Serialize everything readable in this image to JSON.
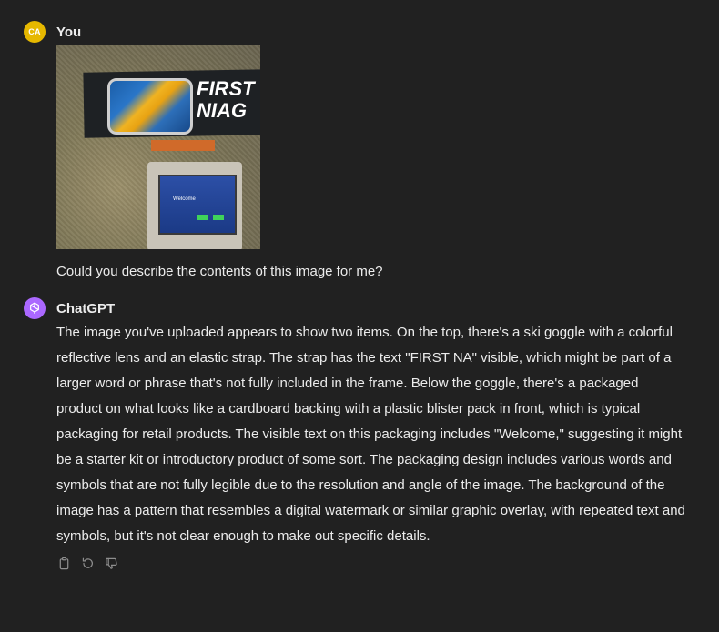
{
  "conversation": {
    "user_message": {
      "avatar_initials": "CA",
      "author": "You",
      "image_text": {
        "brand": "FIRST NIAG",
        "screen": "Welcome"
      },
      "text": "Could you describe the contents of this image for me?"
    },
    "assistant_message": {
      "author": "ChatGPT",
      "text": "The image you've uploaded appears to show two items. On the top, there's a ski goggle with a colorful reflective lens and an elastic strap. The strap has the text \"FIRST NA\" visible, which might be part of a larger word or phrase that's not fully included in the frame. Below the goggle, there's a packaged product on what looks like a cardboard backing with a plastic blister pack in front, which is typical packaging for retail products. The visible text on this packaging includes \"Welcome,\" suggesting it might be a starter kit or introductory product of some sort. The packaging design includes various words and symbols that are not fully legible due to the resolution and angle of the image. The background of the image has a pattern that resembles a digital watermark or similar graphic overlay, with repeated text and symbols, but it's not clear enough to make out specific details.",
      "actions": [
        {
          "icon": "copy-icon"
        },
        {
          "icon": "regenerate-icon"
        },
        {
          "icon": "thumbs-down-icon"
        }
      ]
    }
  },
  "colors": {
    "background": "#212121",
    "text": "#ececec",
    "user_avatar": "#e6b800",
    "assistant_avatar": "#ab68ff",
    "icon": "#8e8e8e"
  }
}
